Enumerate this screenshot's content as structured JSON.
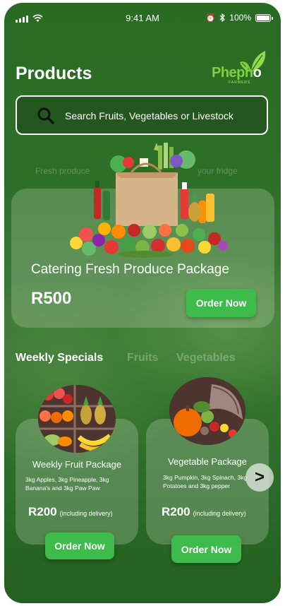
{
  "status_bar": {
    "time": "9:41 AM",
    "battery": "100%"
  },
  "header": {
    "title": "Products"
  },
  "logo": {
    "name": "Phepho",
    "tagline": "FARMERS"
  },
  "search": {
    "placeholder": "Search Fruits, Vegetables or Livestock"
  },
  "featured": {
    "tagline_left": "Fresh produce",
    "tagline_right": "your fridge",
    "name": "Catering Fresh Produce Package",
    "price": "R500",
    "button_label": "Order Now"
  },
  "tabs": [
    {
      "label": "Weekly Specials",
      "active": true
    },
    {
      "label": "Fruits",
      "active": false
    },
    {
      "label": "Vegetables",
      "active": false
    }
  ],
  "packages": [
    {
      "name": "Weekly Fruit Package",
      "description": "3kg Apples, 3kg Pineapple, 3kg Banana's and 3kg Paw Paw",
      "price": "R200",
      "price_note": "(including delivery)",
      "button_label": "Order Now"
    },
    {
      "name": "Vegetable Package",
      "description": "3kg Pumpkin, 3kg Spinach, 3kg Potatoes and 3kg pepper",
      "price": "R200",
      "price_note": "(including delivery)",
      "button_label": "Order Now"
    }
  ],
  "carousel": {
    "next_label": ">"
  },
  "colors": {
    "accent": "#3dbb4b",
    "background": "#2e6f28",
    "logo_green": "#7fd23a"
  }
}
